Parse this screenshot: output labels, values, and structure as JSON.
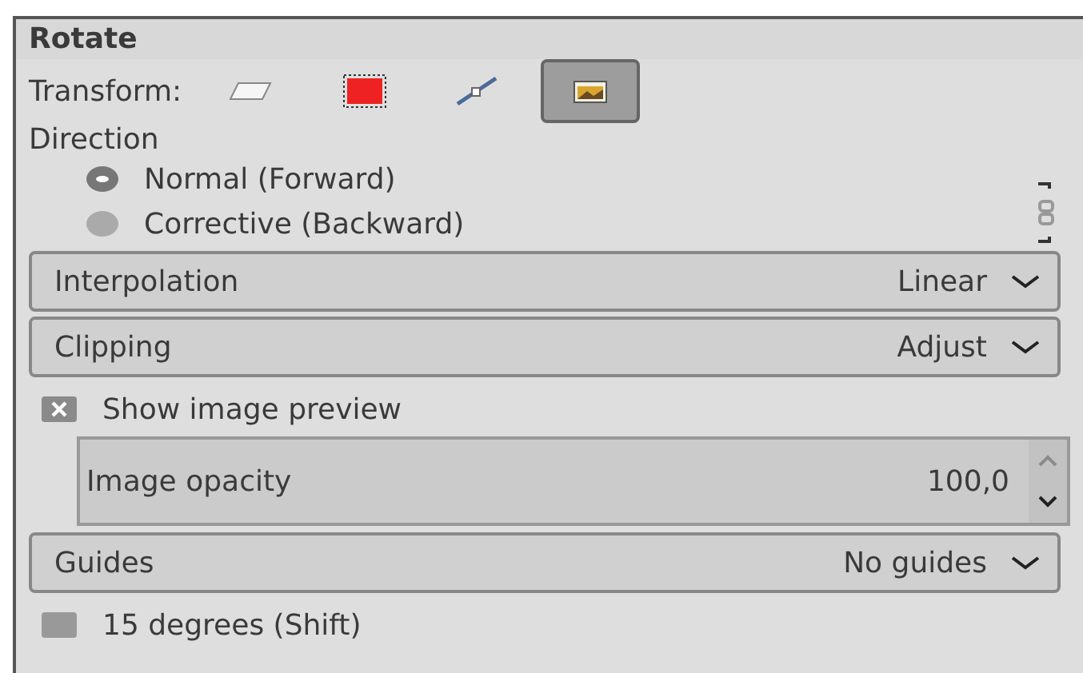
{
  "title": "Rotate",
  "transform": {
    "label": "Transform:",
    "options": [
      {
        "kind": "layer",
        "selected": false
      },
      {
        "kind": "selection",
        "selected": false
      },
      {
        "kind": "path",
        "selected": false
      },
      {
        "kind": "image",
        "selected": true
      }
    ]
  },
  "direction": {
    "label": "Direction",
    "options": [
      {
        "label": "Normal (Forward)",
        "selected": true
      },
      {
        "label": "Corrective (Backward)",
        "selected": false
      }
    ]
  },
  "combos": [
    {
      "label": "Interpolation",
      "value": "Linear"
    },
    {
      "label": "Clipping",
      "value": "Adjust"
    }
  ],
  "preview": {
    "label": "Show image preview",
    "checked": true
  },
  "opacity": {
    "label": "Image opacity",
    "value": "100,0"
  },
  "guides": {
    "label": "Guides",
    "value": "No guides"
  },
  "snap": {
    "label": "15 degrees (Shift)",
    "checked": false
  }
}
